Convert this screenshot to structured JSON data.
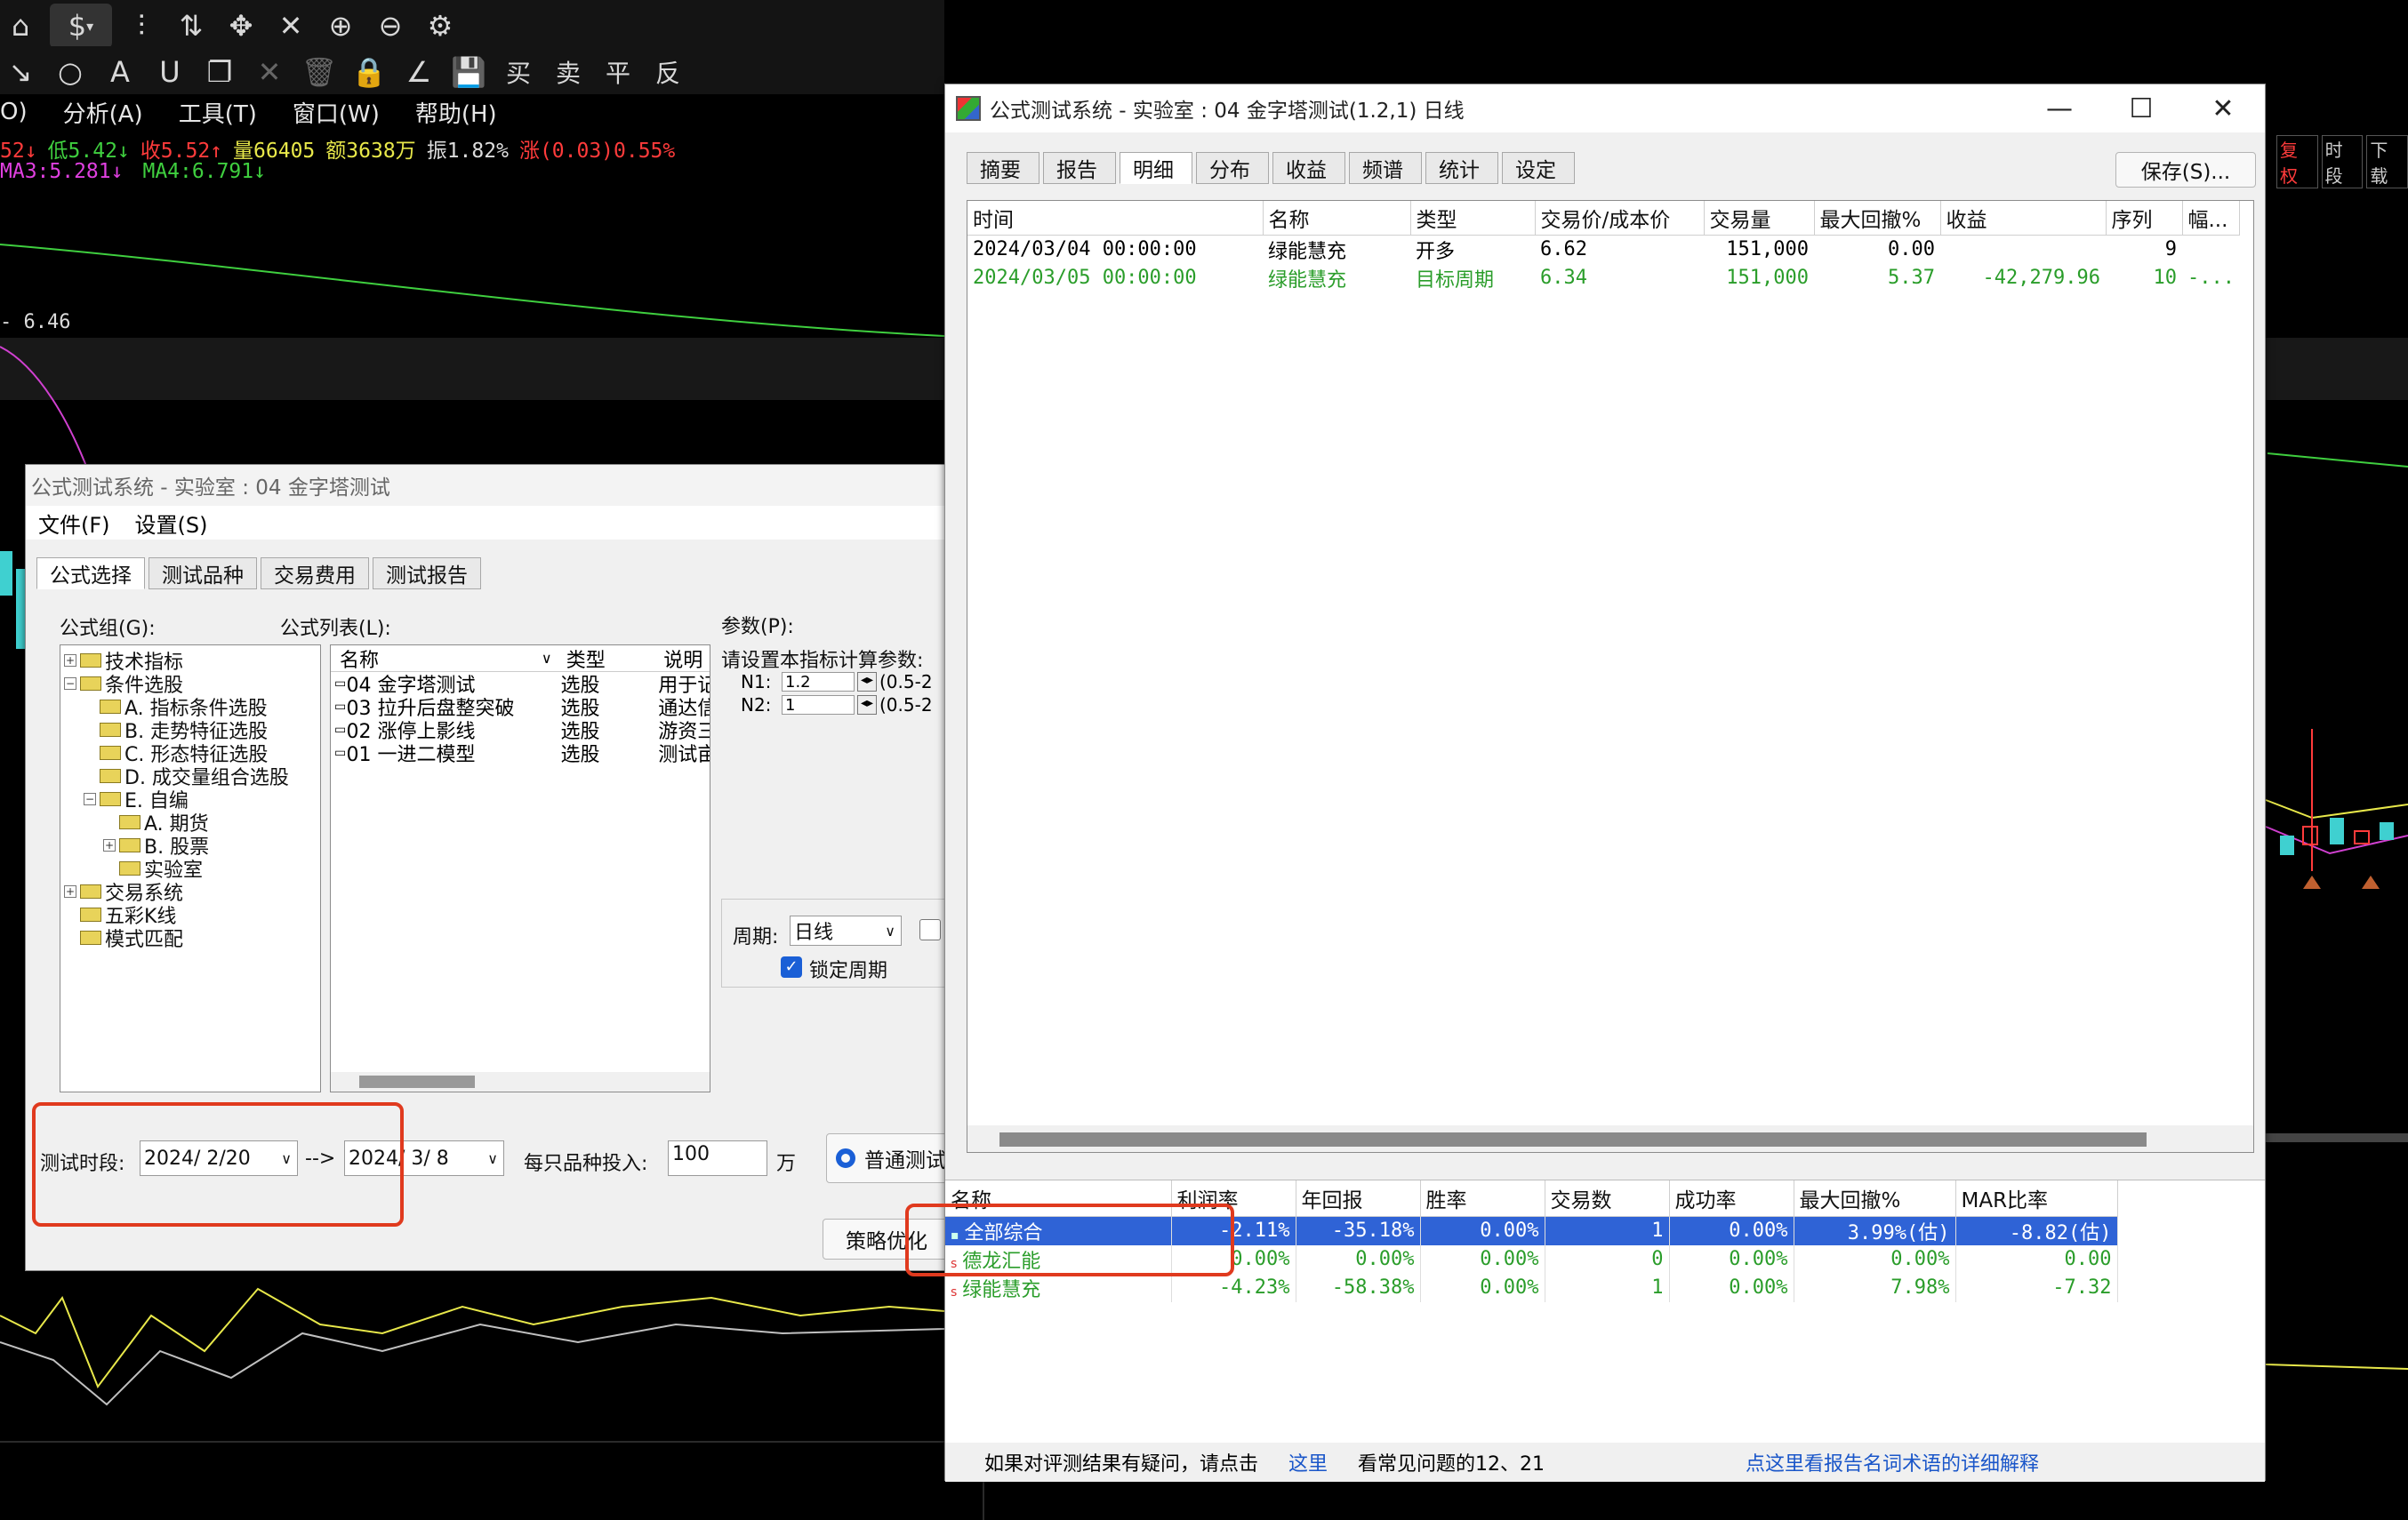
{
  "toolbar1": {
    "dollar": "$",
    "dropdown": "▾"
  },
  "toolbar2": {
    "trade": [
      "买",
      "卖",
      "平",
      "反"
    ]
  },
  "menu": [
    "O)",
    "分析(A)",
    "工具(T)",
    "窗口(W)",
    "帮助(H)"
  ],
  "quote": {
    "line1": [
      {
        "text": "52↓",
        "color": "#ff3b3b"
      },
      {
        "text": "低5.42↓",
        "color": "#3fcf3f"
      },
      {
        "text": "收5.52↑",
        "color": "#ff3b3b"
      },
      {
        "text": "量66405",
        "color": "#e8e84a"
      },
      {
        "text": "额3638万",
        "color": "#e8e84a"
      },
      {
        "text": "振1.82%",
        "color": "#dcdcdc"
      },
      {
        "text": "涨(0.03)0.55%",
        "color": "#ff3b3b"
      }
    ],
    "line2": [
      {
        "text": "MA3:5.281↓",
        "color": "#e040e0"
      },
      {
        "text": "MA4:6.791↓",
        "color": "#3fcf3f"
      }
    ],
    "price_label": "6.46"
  },
  "rightchart": {
    "labels": [
      "复权",
      "时段",
      "下载"
    ]
  },
  "win1": {
    "title": "公式测试系统 - 实验室 : 04 金字塔测试",
    "menu": [
      "文件(F)",
      "设置(S)"
    ],
    "tabs": [
      "公式选择",
      "测试品种",
      "交易费用",
      "测试报告"
    ],
    "group_label": "公式组(G):",
    "list_label": "公式列表(L):",
    "param_label": "参数(P):",
    "tree": [
      {
        "text": "技术指标",
        "level": 0,
        "pm": "+"
      },
      {
        "text": "条件选股",
        "level": 0,
        "pm": "−"
      },
      {
        "text": "A. 指标条件选股",
        "level": 1,
        "pm": ""
      },
      {
        "text": "B. 走势特征选股",
        "level": 1,
        "pm": ""
      },
      {
        "text": "C. 形态特征选股",
        "level": 1,
        "pm": ""
      },
      {
        "text": "D. 成交量组合选股",
        "level": 1,
        "pm": ""
      },
      {
        "text": "E. 自编",
        "level": 1,
        "pm": "−"
      },
      {
        "text": "A. 期货",
        "level": 2,
        "pm": ""
      },
      {
        "text": "B. 股票",
        "level": 2,
        "pm": "+"
      },
      {
        "text": "实验室",
        "level": 2,
        "pm": ""
      },
      {
        "text": "交易系统",
        "level": 0,
        "pm": "+"
      },
      {
        "text": "五彩K线",
        "level": 0,
        "pm": ""
      },
      {
        "text": "模式匹配",
        "level": 0,
        "pm": ""
      }
    ],
    "list_headers": [
      "名称",
      "类型",
      "说明"
    ],
    "list_rows": [
      [
        "04 金字塔测试",
        "选股",
        "用于记"
      ],
      [
        "03 拉升后盘整突破",
        "选股",
        "通达信"
      ],
      [
        "02 涨停上影线",
        "选股",
        "游资三"
      ],
      [
        "01 一进二模型",
        "选股",
        "测试亩"
      ]
    ],
    "param_text": "请设置本指标计算参数:",
    "params": [
      {
        "name": "N1:",
        "value": "1.2",
        "range": "(0.5-2"
      },
      {
        "name": "N2:",
        "value": "1",
        "range": "(0.5-2"
      }
    ],
    "period_label": "周期:",
    "period_value": "日线",
    "lock_label": "锁定周期",
    "test_period_label": "测试时段:",
    "date_from": "2024/ 2/20",
    "arrow": "-->",
    "date_to": "2024/ 3/ 8",
    "invest_label": "每只品种投入:",
    "invest_value": "100",
    "invest_unit": "万",
    "radio_label": "普通测试",
    "opt_button": "策略优化"
  },
  "win2": {
    "title": "公式测试系统 - 实验室 : 04 金字塔测试(1.2,1) 日线",
    "tabs": [
      "摘要",
      "报告",
      "明细",
      "分布",
      "收益",
      "频谱",
      "统计",
      "设定"
    ],
    "save_button": "保存(S)...",
    "headers": [
      "时间",
      "名称",
      "类型",
      "交易价/成本价",
      "交易量",
      "最大回撤%",
      "收益",
      "序列",
      "幅..."
    ],
    "rows": [
      {
        "cells": [
          "2024/03/04 00:00:00",
          "绿能慧充",
          "开多",
          "6.62",
          "151,000",
          "0.00",
          "",
          "9",
          ""
        ],
        "green": false
      },
      {
        "cells": [
          "2024/03/05 00:00:00",
          "绿能慧充",
          "目标周期",
          "6.34",
          "151,000",
          "5.37",
          "-42,279.96",
          "10",
          "-..."
        ],
        "green": true
      }
    ],
    "sum_headers": [
      "名称",
      "利润率",
      "年回报",
      "胜率",
      "交易数",
      "成功率",
      "最大回撤%",
      "MAR比率"
    ],
    "sum_rows": [
      {
        "cells": [
          "全部综合",
          "-2.11%",
          "-35.18%",
          "0.00%",
          "1",
          "0.00%",
          "3.99%(估)",
          "-8.82(估)"
        ],
        "style": "sel",
        "mark": "▪"
      },
      {
        "cells": [
          "德龙汇能",
          "0.00%",
          "0.00%",
          "0.00%",
          "0",
          "0.00%",
          "0.00%",
          "0.00"
        ],
        "style": "green",
        "mark": "s"
      },
      {
        "cells": [
          "绿能慧充",
          "-4.23%",
          "-58.38%",
          "0.00%",
          "1",
          "0.00%",
          "7.98%",
          "-7.32"
        ],
        "style": "green",
        "mark": "s"
      }
    ],
    "footer": {
      "text1": "如果对评测结果有疑问，请点击",
      "link1": "这里",
      "text2": "看常见问题的12、21",
      "link2": "点这里看报告名词术语的详细解释"
    }
  }
}
